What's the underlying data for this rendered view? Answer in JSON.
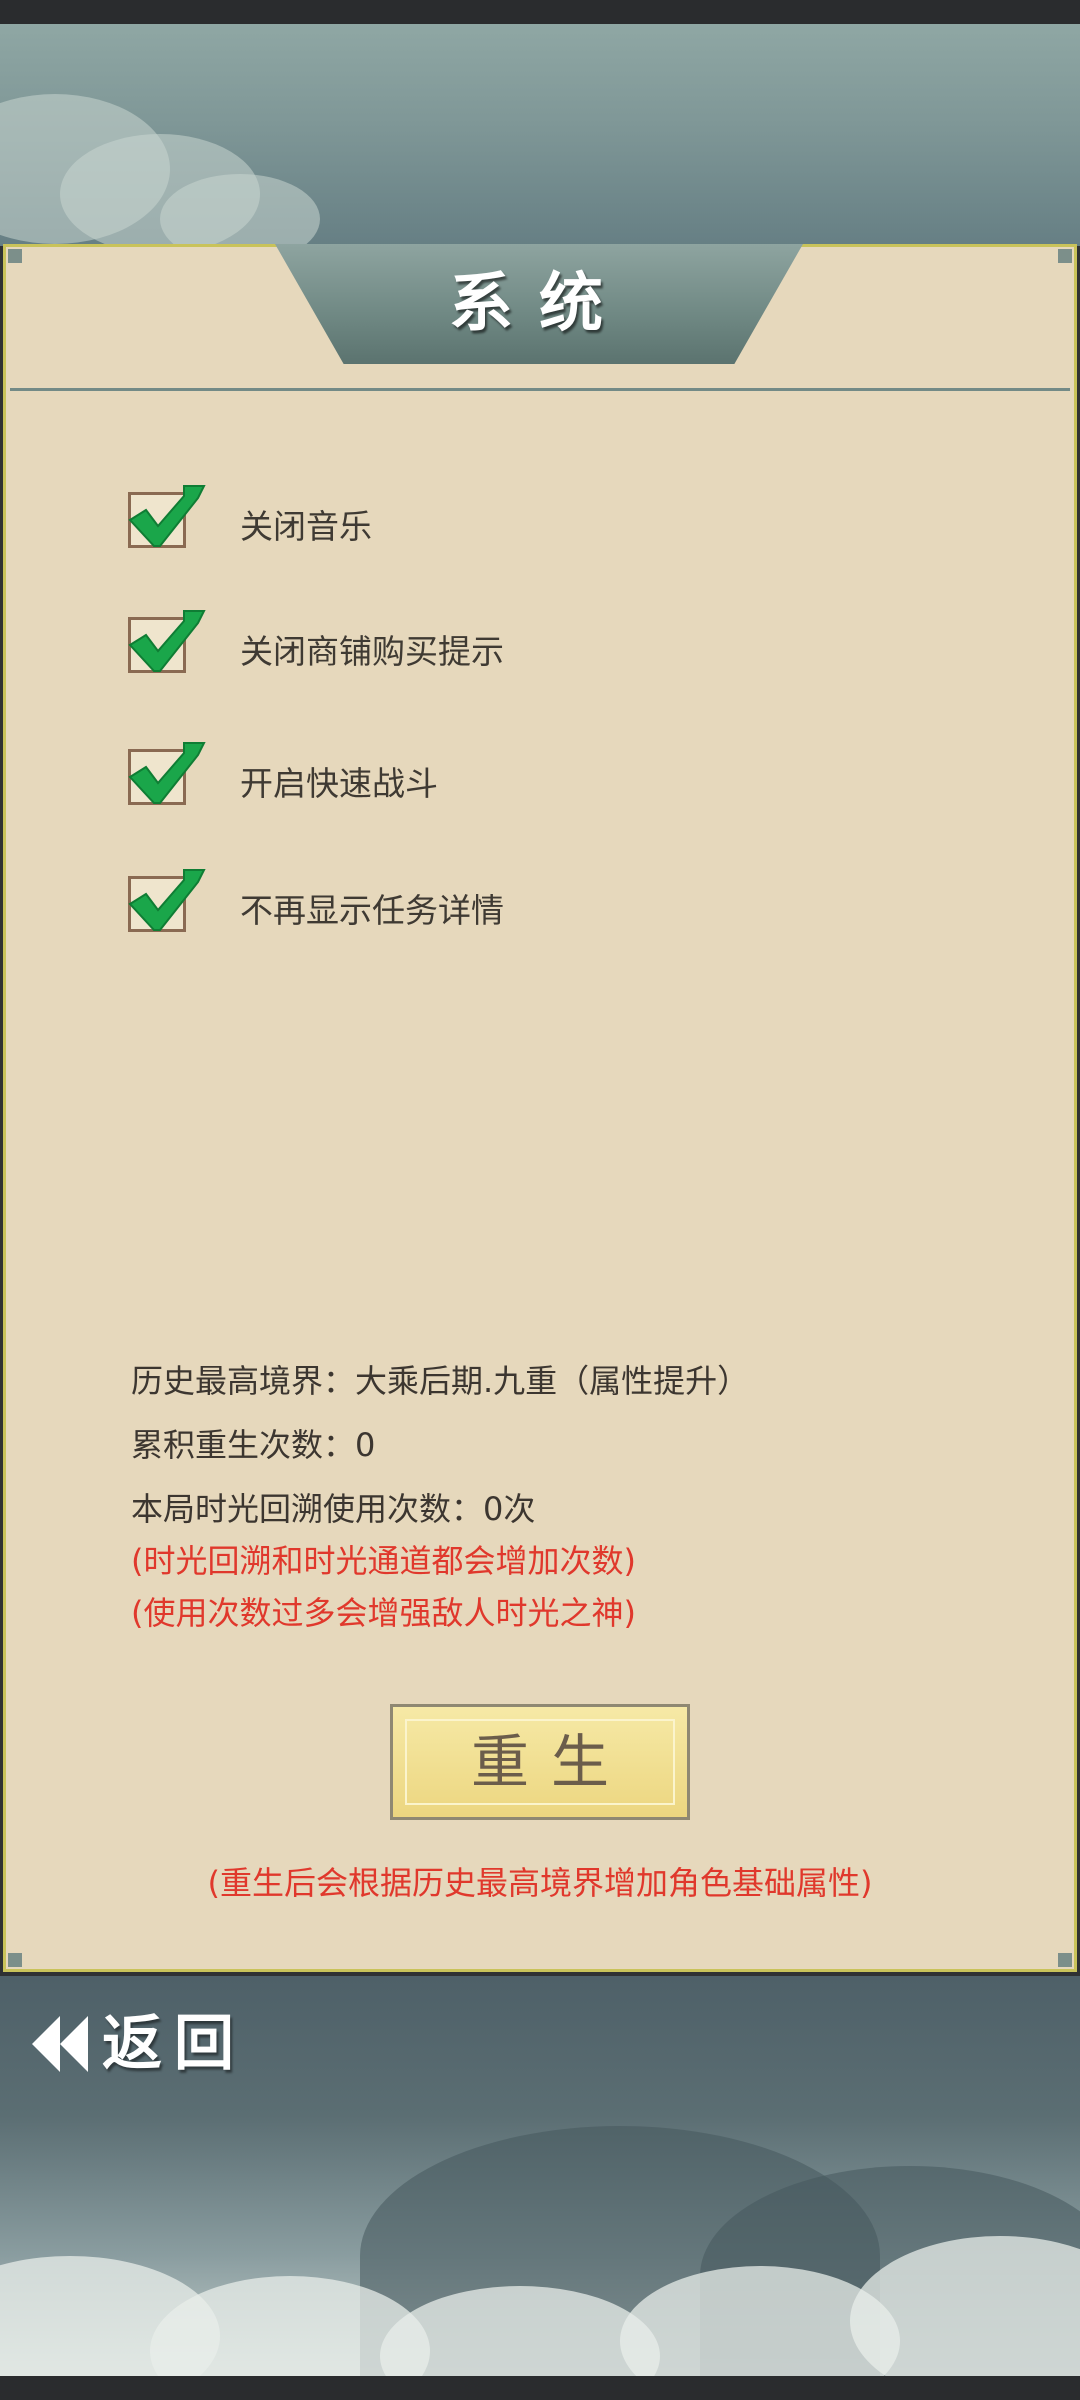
{
  "dialog": {
    "title": "系统"
  },
  "options": [
    {
      "label": "关闭音乐",
      "checked": true
    },
    {
      "label": "关闭商铺购买提示",
      "checked": true
    },
    {
      "label": "开启快速战斗",
      "checked": true
    },
    {
      "label": "不再显示任务详情",
      "checked": true
    }
  ],
  "info": {
    "highest_realm": "历史最高境界：大乘后期.九重（属性提升）",
    "rebirth_count": "累积重生次数：0",
    "rewind_count": "本局时光回溯使用次数：0次",
    "note_1": "(时光回溯和时光通道都会增加次数)",
    "note_2": "(使用次数过多会增强敌人时光之神)"
  },
  "rebirth": {
    "button_label": "重生",
    "note": "(重生后会根据历史最高境界增加角色基础属性)"
  },
  "nav": {
    "back_label": "返回"
  },
  "colors": {
    "panel_bg": "#e6d8bc",
    "panel_border": "#c9c35a",
    "check_green": "#1aa64a",
    "warning_red": "#e0382c",
    "button_gold": "#ecd680"
  },
  "icons": {
    "checkbox": "checkmark-icon",
    "back": "double-chevron-left-icon"
  }
}
